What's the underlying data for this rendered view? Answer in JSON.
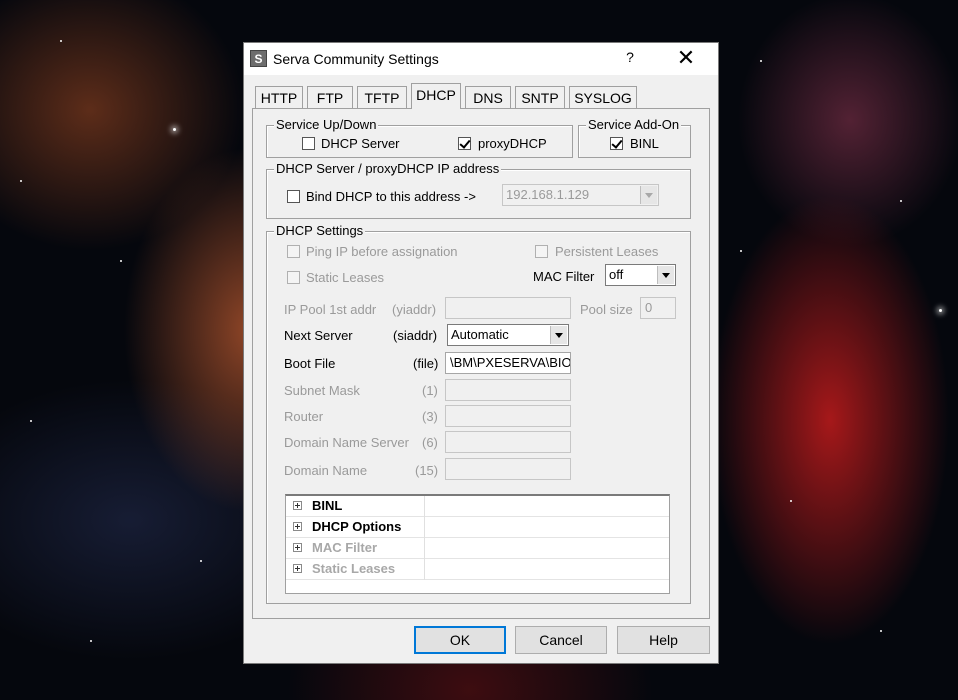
{
  "window": {
    "title": "Serva Community Settings",
    "help_glyph": "?",
    "close_glyph": "✕",
    "app_icon_letter": "S"
  },
  "tabs": [
    {
      "label": "HTTP"
    },
    {
      "label": "FTP"
    },
    {
      "label": "TFTP"
    },
    {
      "label": "DHCP",
      "active": true
    },
    {
      "label": "DNS"
    },
    {
      "label": "SNTP"
    },
    {
      "label": "SYSLOG"
    }
  ],
  "service_updown": {
    "label": "Service Up/Down",
    "dhcp_server": {
      "label": "DHCP Server",
      "checked": false
    },
    "proxy_dhcp": {
      "label": "proxyDHCP",
      "checked": true
    }
  },
  "service_addon": {
    "label": "Service Add-On",
    "binl": {
      "label": "BINL",
      "checked": true
    }
  },
  "ip_group": {
    "label": "DHCP Server / proxyDHCP IP address",
    "bind_label": "Bind DHCP to this address  ->",
    "bind_checked": false,
    "address": "192.168.1.129"
  },
  "settings": {
    "label": "DHCP Settings",
    "ping_ip": "Ping IP before assignation",
    "persistent_leases": "Persistent Leases",
    "static_leases": "Static Leases",
    "mac_filter_label": "MAC Filter",
    "mac_filter_value": "off",
    "ip_pool_label": "IP Pool 1st addr",
    "ip_pool_tag": "(yiaddr)",
    "ip_pool_value": "",
    "pool_size_label": "Pool size",
    "pool_size_value": "0",
    "next_server_label": "Next Server",
    "next_server_tag": "(siaddr)",
    "next_server_value": "Automatic",
    "boot_file_label": "Boot File",
    "boot_file_tag": "(file)",
    "boot_file_value": "\\BM\\PXESERVA\\BIO",
    "subnet_label": "Subnet Mask",
    "subnet_tag": "(1)",
    "router_label": "Router",
    "router_tag": "(3)",
    "dns_label": "Domain Name Server",
    "dns_tag": "(6)",
    "domain_label": "Domain Name",
    "domain_tag": "(15)"
  },
  "tree": [
    {
      "label": "BINL",
      "enabled": true
    },
    {
      "label": "DHCP Options",
      "enabled": true
    },
    {
      "label": "MAC Filter",
      "enabled": false
    },
    {
      "label": "Static Leases",
      "enabled": false
    }
  ],
  "buttons": {
    "ok": "OK",
    "cancel": "Cancel",
    "help": "Help"
  }
}
